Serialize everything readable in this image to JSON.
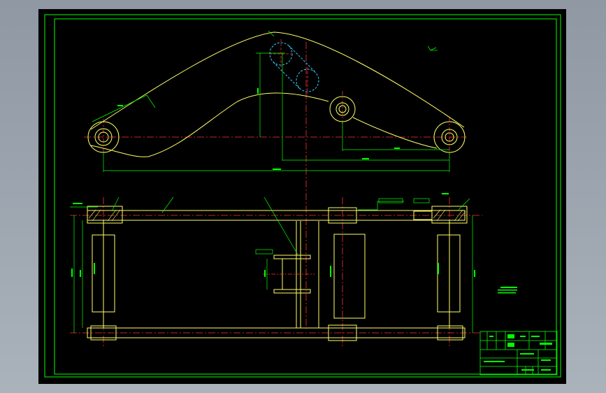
{
  "colors": {
    "background": "#000000",
    "frame": "#00ff00",
    "outline": "#ffff66",
    "centerline": "#ff3333",
    "hidden": "#33ccff",
    "dimension": "#00ff00",
    "text": "#ffffff"
  },
  "icons": {
    "ucs": "ucs-axis-icon"
  }
}
